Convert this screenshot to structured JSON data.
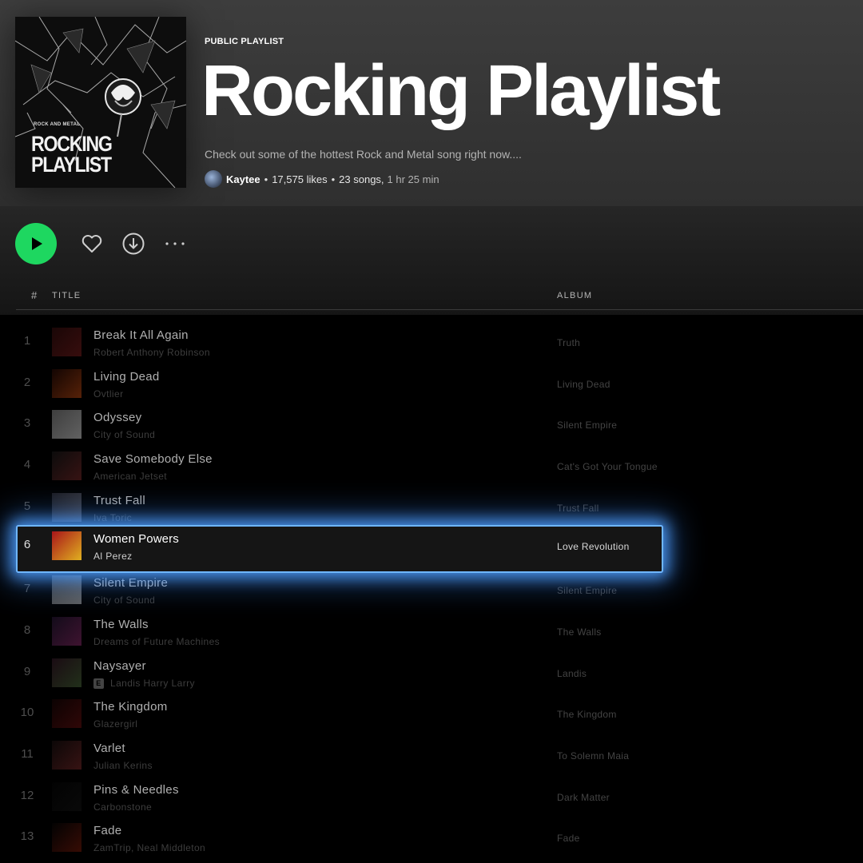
{
  "playlist": {
    "cover_kicker": "ROCK AND METAL",
    "cover_title": "ROCKING PLAYLIST",
    "type_label": "PUBLIC PLAYLIST",
    "title": "Rocking Playlist",
    "description": "Check out some of the hottest Rock and Metal song right now....",
    "owner": "Kaytee",
    "likes": "17,575 likes",
    "songs": "23 songs,",
    "duration": "1 hr 25 min",
    "separator": "•"
  },
  "actions": {
    "play_icon": "play-icon",
    "heart_icon": "heart-icon",
    "download_icon": "download-icon",
    "more_icon": "more-icon"
  },
  "table": {
    "col_num": "#",
    "col_title": "TITLE",
    "col_album": "ALBUM"
  },
  "colors": {
    "accent": "#1ed760",
    "highlight": "#6fb6ff"
  },
  "tracks": [
    {
      "num": "1",
      "title": "Break It All Again",
      "artist": "Robert Anthony Robinson",
      "album": "Truth",
      "explicit": false,
      "active": false,
      "art_colors": [
        "#3a0f0f",
        "#7a1d1d"
      ]
    },
    {
      "num": "2",
      "title": "Living Dead",
      "artist": "Ovtlier",
      "album": "Living Dead",
      "explicit": false,
      "active": false,
      "art_colors": [
        "#2a0b05",
        "#c04a12"
      ]
    },
    {
      "num": "3",
      "title": "Odyssey",
      "artist": "City of Sound",
      "album": "Silent Empire",
      "explicit": false,
      "active": false,
      "art_colors": [
        "#8a8a8a",
        "#d8d8d8"
      ]
    },
    {
      "num": "4",
      "title": "Save Somebody Else",
      "artist": "American Jetset",
      "album": "Cat's Got Your Tongue",
      "explicit": false,
      "active": false,
      "art_colors": [
        "#1a1a1a",
        "#7a2a2a"
      ]
    },
    {
      "num": "5",
      "title": "Trust Fall",
      "artist": "Iva Toric",
      "album": "Trust Fall",
      "explicit": false,
      "active": false,
      "art_colors": [
        "#3c3c48",
        "#8a8a9a"
      ]
    },
    {
      "num": "6",
      "title": "Women Powers",
      "artist": "Al Perez",
      "album": "Love Revolution",
      "explicit": false,
      "active": true,
      "art_colors": [
        "#a8151a",
        "#e0b020"
      ]
    },
    {
      "num": "7",
      "title": "Silent Empire",
      "artist": "City of Sound",
      "album": "Silent Empire",
      "explicit": false,
      "active": false,
      "art_colors": [
        "#8a8a8a",
        "#d0d0d0"
      ]
    },
    {
      "num": "8",
      "title": "The Walls",
      "artist": "Dreams of Future Machines",
      "album": "The Walls",
      "explicit": false,
      "active": false,
      "art_colors": [
        "#2a1a3a",
        "#8a2a6a"
      ]
    },
    {
      "num": "9",
      "title": "Naysayer",
      "artist": "Landis Harry Larry",
      "album": "Landis",
      "explicit": true,
      "active": false,
      "art_colors": [
        "#3a1a2a",
        "#4a6a3a"
      ]
    },
    {
      "num": "10",
      "title": "The Kingdom",
      "artist": "Glazergirl",
      "album": "The Kingdom",
      "explicit": false,
      "active": false,
      "art_colors": [
        "#1a0505",
        "#6a1010"
      ]
    },
    {
      "num": "11",
      "title": "Varlet",
      "artist": "Julian Kerins",
      "album": "To Solemn Maia",
      "explicit": false,
      "active": false,
      "art_colors": [
        "#1a1010",
        "#7a2a2a"
      ]
    },
    {
      "num": "12",
      "title": "Pins & Needles",
      "artist": "Carbonstone",
      "album": "Dark Matter",
      "explicit": false,
      "active": false,
      "art_colors": [
        "#050505",
        "#141414"
      ]
    },
    {
      "num": "13",
      "title": "Fade",
      "artist": "ZamTrip, Neal Middleton",
      "album": "Fade",
      "explicit": false,
      "active": false,
      "art_colors": [
        "#050505",
        "#7a1a0a"
      ]
    }
  ]
}
